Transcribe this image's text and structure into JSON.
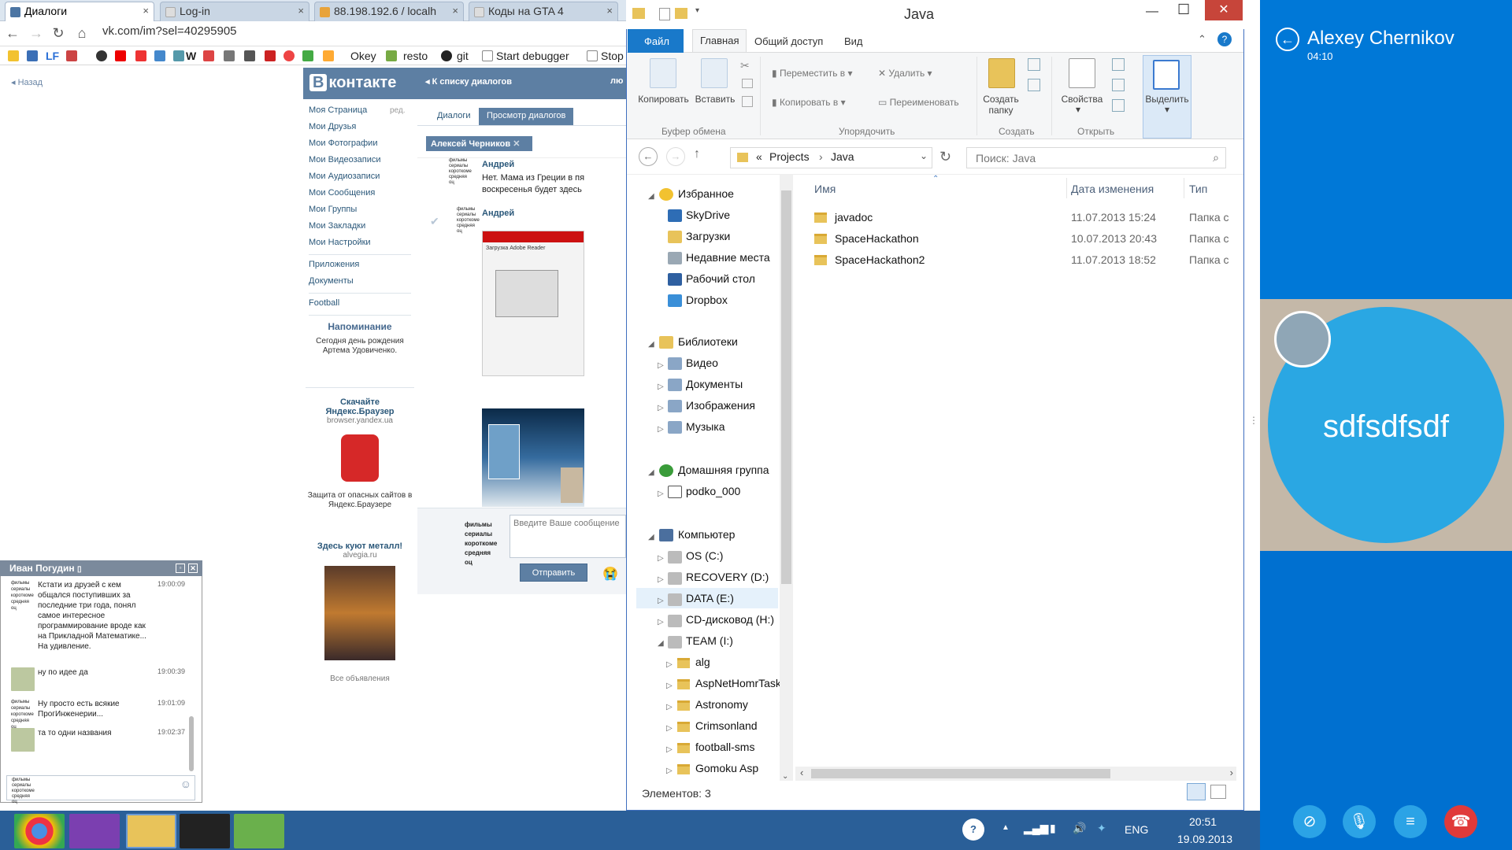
{
  "chrome": {
    "tabs": [
      {
        "label": "Диалоги",
        "close": "×"
      },
      {
        "label": "Log-in",
        "close": "×"
      },
      {
        "label": "88.198.192.6 / localh",
        "close": "×"
      },
      {
        "label": "Коды на GTA 4",
        "close": "×"
      }
    ],
    "url": "vk.com/im?sel=40295905",
    "bookmarks": [
      "LF",
      "W",
      "Okey",
      "resto",
      "git",
      "Start debugger",
      "Stop"
    ]
  },
  "vk": {
    "back": "Назад",
    "logo": "контакте",
    "list_link": "К списку диалогов",
    "header_right": "лю",
    "menu": [
      "Моя Страница",
      "Мои Друзья",
      "Мои Фотографии",
      "Мои Видеозаписи",
      "Мои Аудиозаписи",
      "Мои Сообщения",
      "Мои Группы",
      "Мои Закладки",
      "Мои Настройки",
      "Приложения",
      "Документы",
      "Football"
    ],
    "edit": "ред.",
    "reminder_title": "Напоминание",
    "reminder_text": "Сегодня день рождения Артема Удовиченко.",
    "ad1_title": "Скачайте Яндекс.Браузер",
    "ad1_url": "browser.yandex.ua",
    "ad1_text": "Защита от опасных сайтов в Яндекс.Браузере",
    "ad2_title": "Здесь куют металл!",
    "ad2_url": "alvegia.ru",
    "all_ads": "Все объявления",
    "tab_dialogs": "Диалоги",
    "tab_view": "Просмотр диалогов",
    "chip": "Алексей Черников",
    "messages": [
      {
        "author": "Андрей",
        "text": "Нет. Мама из Греции в пя воскресенья будет здесь"
      },
      {
        "author": "Андрей",
        "text": ""
      }
    ],
    "avatar_text": "фильмы сериалы короткоме средняя оц",
    "compose_placeholder": "Введите Ваше сообщение",
    "send": "Отправить",
    "screenshot_title": "Загрузка Adobe Reader"
  },
  "chat": {
    "title": "Иван Погудин",
    "messages": [
      {
        "text": "Кстати из друзей с кем общался поступивших за последние три года, понял самое интересное программирование вроде как на Прикладной Математике... На удивление.",
        "time": "19:00:09",
        "avatar_text": "фильмы сериалы короткоме средняя оц"
      },
      {
        "text": "ну по идее да",
        "time": "19:00:39",
        "avatar_text": ""
      },
      {
        "text": "Ну просто есть всякие ПрогИнженерии...",
        "time": "19:01:09",
        "avatar_text": "фильмы сериалы короткоме средняя оц"
      },
      {
        "text": "та то одни названия",
        "time": "19:02:37",
        "avatar_text": ""
      }
    ],
    "input_avatar_text": "фильмы сериалы короткоме средняя оц"
  },
  "explorer": {
    "title": "Java",
    "ribbon_tabs": [
      "Файл",
      "Главная",
      "Общий доступ",
      "Вид"
    ],
    "buttons": {
      "copy": "Копировать",
      "paste": "Вставить",
      "move": "Переместить в",
      "copy_to": "Копировать в",
      "delete": "Удалить",
      "rename": "Переименовать",
      "new_folder": "Создать папку",
      "properties": "Свойства",
      "select": "Выделить"
    },
    "groups": [
      "Буфер обмена",
      "Упорядочить",
      "Создать",
      "Открыть"
    ],
    "path": [
      "«",
      "Projects",
      "Java"
    ],
    "search_placeholder": "Поиск: Java",
    "columns": [
      "Имя",
      "Дата изменения",
      "Тип"
    ],
    "files": [
      {
        "name": "javadoc",
        "date": "11.07.2013 15:24",
        "type": "Папка с"
      },
      {
        "name": "SpaceHackathon",
        "date": "10.07.2013 20:43",
        "type": "Папка с"
      },
      {
        "name": "SpaceHackathon2",
        "date": "11.07.2013 18:52",
        "type": "Папка с"
      }
    ],
    "tree": {
      "favorites": "Избранное",
      "fav_items": [
        "SkyDrive",
        "Загрузки",
        "Недавние места",
        "Рабочий стол",
        "Dropbox"
      ],
      "libraries": "Библиотеки",
      "lib_items": [
        "Видео",
        "Документы",
        "Изображения",
        "Музыка"
      ],
      "homegroup": "Домашняя группа",
      "home_items": [
        "podko_000"
      ],
      "computer": "Компьютер",
      "drives": [
        "OS (C:)",
        "RECOVERY (D:)",
        "DATA (E:)",
        "CD-дисковод (H:)",
        "TEAM (I:)"
      ],
      "team_items": [
        "alg",
        "AspNetHomrTask",
        "Astronomy",
        "Crimsonland",
        "football-sms",
        "Gomoku Asp"
      ]
    },
    "status": "Элементов: 3"
  },
  "skype": {
    "name": "Alexey Chernikov",
    "time": "04:10",
    "bubble": "sdfsdfsdf"
  },
  "taskbar": {
    "lang": "ENG",
    "time": "20:51",
    "date": "19.09.2013",
    "apps": [
      "chrome-icon",
      "phpstorm-icon",
      "explorer-icon",
      "touch-icon",
      "utorrent-icon"
    ]
  }
}
